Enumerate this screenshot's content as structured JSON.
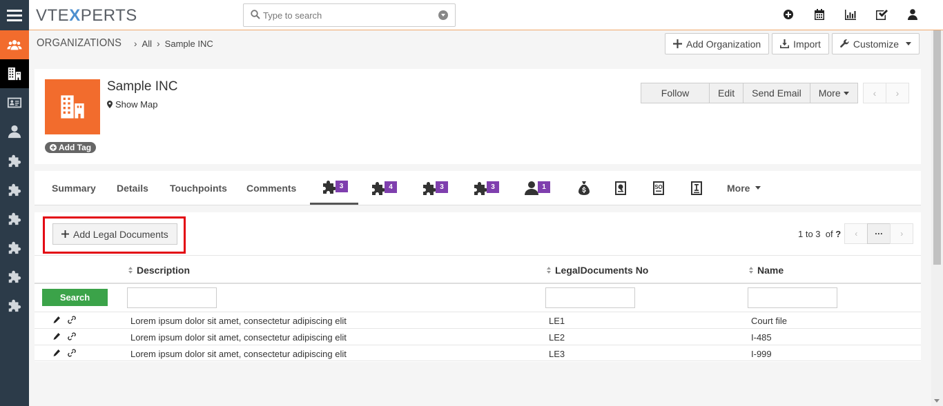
{
  "app": {
    "logo_left": "VTE",
    "logo_x": "X",
    "logo_right": "PERTS"
  },
  "search": {
    "placeholder": "Type to search"
  },
  "topbar_icons": [
    "add-icon",
    "calendar-icon",
    "reports-icon",
    "tasks-icon",
    "user-icon"
  ],
  "sidebar_icons": [
    "contacts-group-icon",
    "organizations-icon",
    "contact-card-icon",
    "person-icon",
    "puzzle-icon",
    "puzzle-icon",
    "puzzle-icon",
    "puzzle-icon",
    "puzzle-icon",
    "puzzle-icon"
  ],
  "breadcrumb": {
    "module": "ORGANIZATIONS",
    "filter": "All",
    "record": "Sample INC"
  },
  "header_buttons": {
    "add_org": "Add Organization",
    "import": "Import",
    "customize": "Customize"
  },
  "record": {
    "name": "Sample INC",
    "show_map": "Show Map",
    "add_tag": "Add Tag"
  },
  "record_actions": {
    "follow": "Follow",
    "edit": "Edit",
    "send_email": "Send Email",
    "more": "More"
  },
  "tabs": {
    "summary": "Summary",
    "details": "Details",
    "touchpoints": "Touchpoints",
    "comments": "Comments",
    "badges": [
      "3",
      "4",
      "3",
      "3",
      "1"
    ],
    "more": "More"
  },
  "related": {
    "add_button": "Add Legal Documents",
    "pager_range": "1 to 3",
    "pager_of": "of",
    "pager_total": "?",
    "columns": [
      "Description",
      "LegalDocuments No",
      "Name"
    ],
    "search_label": "Search",
    "rows": [
      {
        "description": "Lorem ipsum dolor sit amet, consectetur adipiscing elit",
        "number": "LE1",
        "name": "Court file"
      },
      {
        "description": "Lorem ipsum dolor sit amet, consectetur adipiscing elit",
        "number": "LE2",
        "name": "I-485"
      },
      {
        "description": "Lorem ipsum dolor sit amet, consectetur adipiscing elit",
        "number": "LE3",
        "name": "I-999"
      }
    ]
  },
  "colors": {
    "sidebar": "#2c3b49",
    "accent_orange": "#f26c2d",
    "badge_purple": "#7f3fae",
    "search_green": "#3ba349",
    "highlight_red": "#e30613"
  }
}
